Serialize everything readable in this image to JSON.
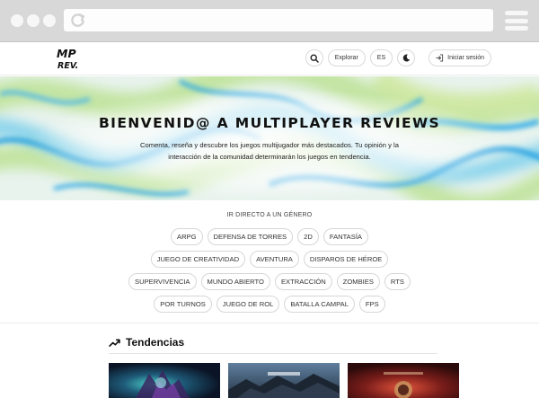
{
  "header": {
    "explore_label": "Explorar",
    "language_label": "ES",
    "login_label": "Iniciar sesión"
  },
  "hero": {
    "title": "BIENVENID@ A MULTIPLAYER REVIEWS",
    "subtitle": "Comenta, reseña y descubre los juegos multijugador más destacados. Tu opinión y la interacción de la comunidad determinarán los juegos en tendencia."
  },
  "genres": {
    "heading": "IR DIRECTO A UN GÉNERO",
    "items": [
      "ARPG",
      "DEFENSA DE TORRES",
      "2D",
      "FANTASÍA",
      "JUEGO DE CREATIVIDAD",
      "AVENTURA",
      "DISPAROS DE HÉROE",
      "SUPERVIVENCIA",
      "MUNDO ABIERTO",
      "EXTRACCIÓN",
      "ZOMBIES",
      "RTS",
      "POR TURNOS",
      "JUEGO DE ROL",
      "BATALLA CAMPAL",
      "FPS"
    ]
  },
  "trending": {
    "title": "Tendencias",
    "cards": [
      {
        "name": "game-card-1"
      },
      {
        "name": "game-card-2"
      },
      {
        "name": "game-card-3"
      }
    ]
  },
  "icons": {
    "search": "search-icon",
    "theme": "moon-icon",
    "login": "login-icon",
    "trend": "trending-up-icon"
  }
}
